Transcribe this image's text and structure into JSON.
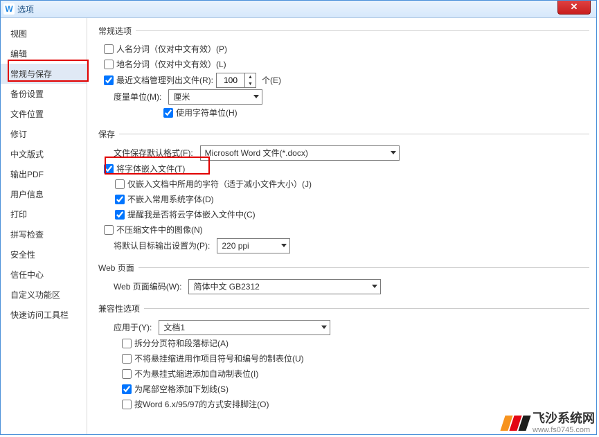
{
  "window": {
    "title": "选项",
    "icon_letter": "W"
  },
  "sidebar": {
    "items": [
      "视图",
      "编辑",
      "常规与保存",
      "备份设置",
      "文件位置",
      "修订",
      "中文版式",
      "输出PDF",
      "用户信息",
      "打印",
      "拼写检查",
      "安全性",
      "信任中心",
      "自定义功能区",
      "快速访问工具栏"
    ],
    "selected_index": 2
  },
  "general": {
    "legend": "常规选项",
    "name_split": "人名分词（仅对中文有效）(P)",
    "place_split": "地名分词（仅对中文有效）(L)",
    "recent_docs_label": "最近文档管理列出文件(R):",
    "recent_docs_value": "100",
    "recent_docs_unit": "个(E)",
    "unit_label": "度量单位(M):",
    "unit_value": "厘米",
    "use_char_unit": "使用字符单位(H)"
  },
  "save": {
    "legend": "保存",
    "format_label": "文件保存默认格式(F):",
    "format_value": "Microsoft Word 文件(*.docx)",
    "embed_fonts": "将字体嵌入文件(T)",
    "embed_used_only": "仅嵌入文档中所用的字符（适于减小文件大小）(J)",
    "no_common_fonts": "不嵌入常用系统字体(D)",
    "cloud_font_prompt": "提醒我是否将云字体嵌入文件中(C)",
    "no_compress_img": "不压缩文件中的图像(N)",
    "target_output_label": "将默认目标输出设置为(P):",
    "target_output_value": "220 ppi"
  },
  "web": {
    "legend": "Web 页面",
    "encoding_label": "Web 页面编码(W):",
    "encoding_value": "简体中文 GB2312"
  },
  "compat": {
    "legend": "兼容性选项",
    "apply_label": "应用于(Y):",
    "apply_value": "文档1",
    "opts": [
      "拆分分页符和段落标记(A)",
      "不将悬挂缩进用作项目符号和编号的制表位(U)",
      "不为悬挂式缩进添加自动制表位(I)",
      "为尾部空格添加下划线(S)",
      "按Word 6.x/95/97的方式安排脚注(O)"
    ],
    "checked_index": 3
  },
  "watermark": {
    "name": "飞沙系统网",
    "url": "www.fs0745.com"
  }
}
